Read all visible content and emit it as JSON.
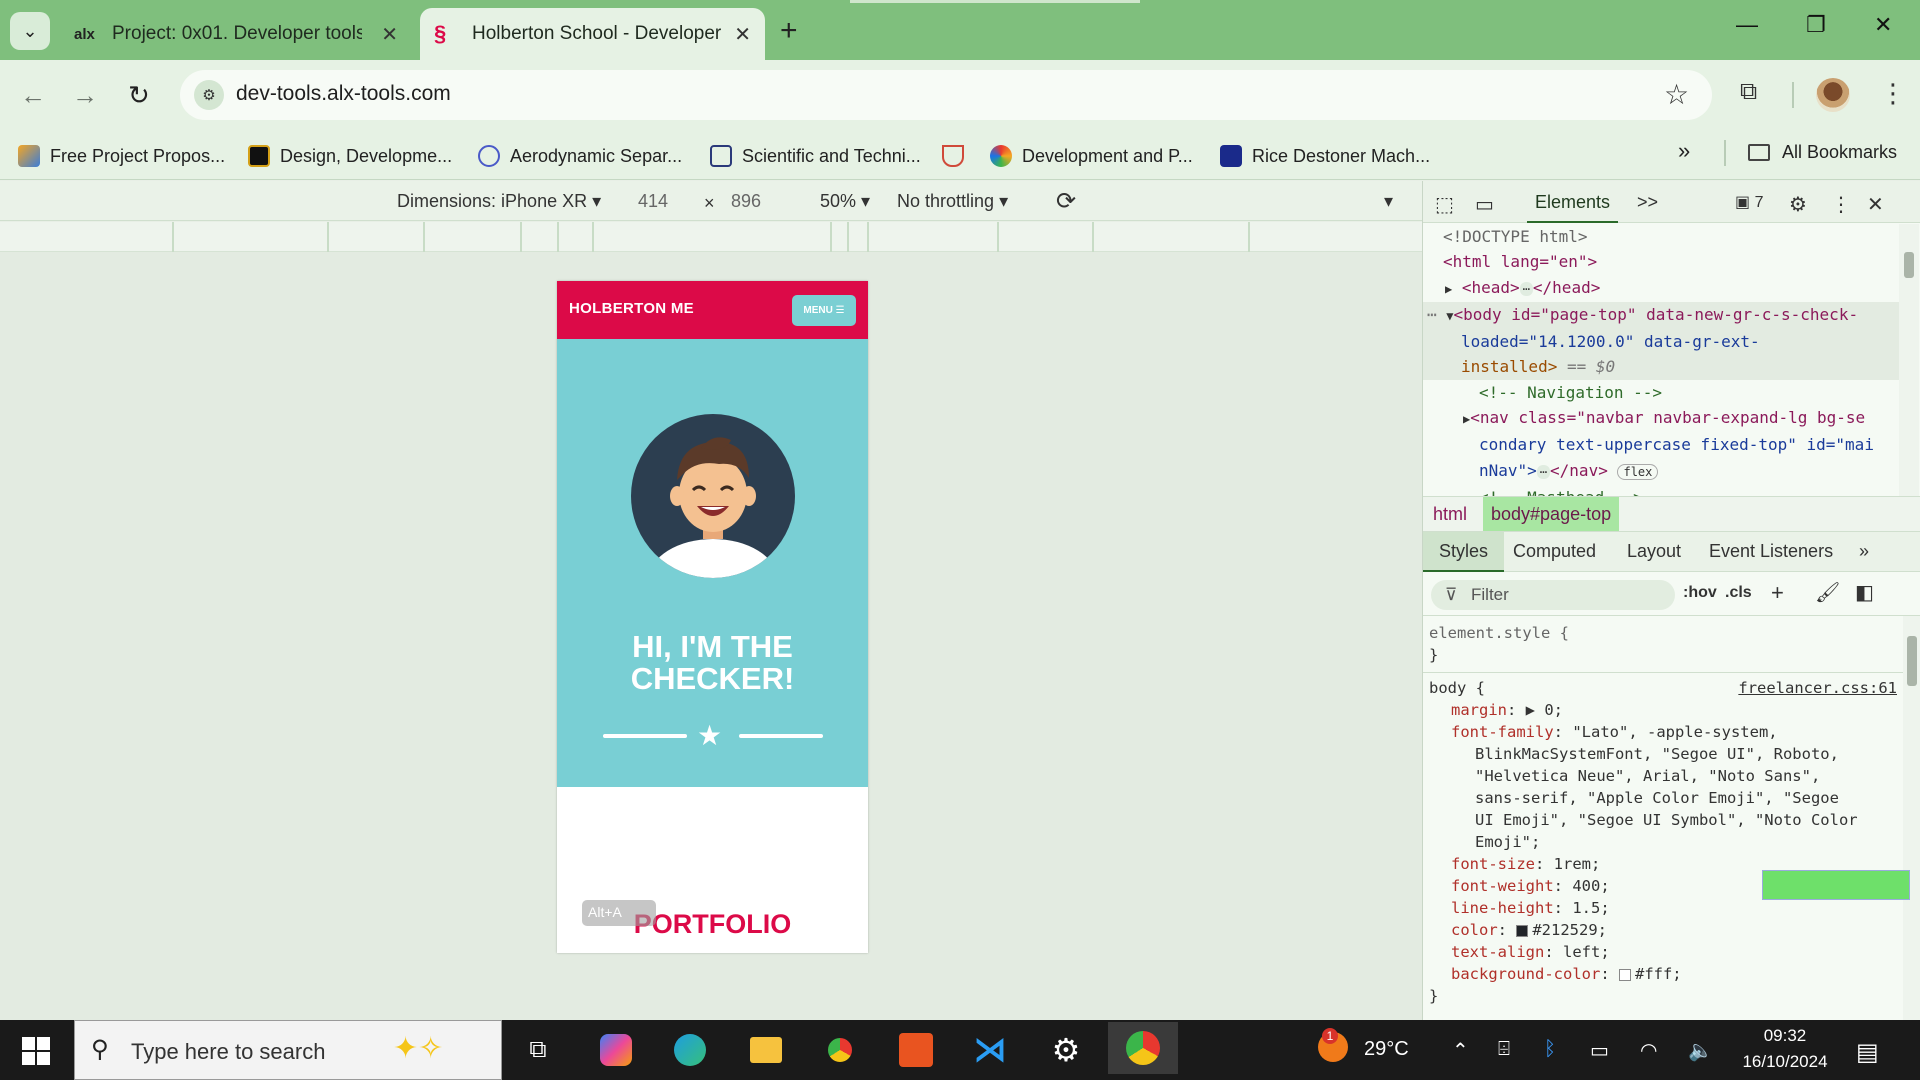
{
  "browser": {
    "tabs": [
      {
        "favicon": "alx",
        "title": "Project: 0x01. Developer tools |"
      },
      {
        "favicon": "seahorse",
        "title": "Holberton School - Developer t"
      }
    ],
    "url": "dev-tools.alx-tools.com",
    "bookmarks": [
      "Free Project Propos...",
      "Design, Developme...",
      "Aerodynamic Separ...",
      "Scientific and Techni...",
      "",
      "Development and P...",
      "Rice Destoner Mach..."
    ],
    "bookmarks_more": "»",
    "all_bookmarks": "All Bookmarks"
  },
  "device_toolbar": {
    "dimensions_label": "Dimensions: iPhone XR",
    "width": "414",
    "times": "×",
    "height": "896",
    "zoom": "50%",
    "throttling": "No throttling"
  },
  "site": {
    "brand": "HOLBERTON ME",
    "menu_button": "MENU",
    "hero_line1": "HI, I'M THE",
    "hero_line2": "CHECKER!",
    "portfolio_heading": "PORTFOLIO",
    "overlay_hint": "Alt+A"
  },
  "devtools": {
    "elements_tab": "Elements",
    "more_tabs": ">>",
    "issues_count": "7",
    "dom_lines": [
      {
        "html": "<span class='cmt'>&lt;!DOCTYPE html&gt;</span>",
        "indent": 0
      },
      {
        "html": "<span class='tag'>&lt;html</span> <span class='attr-n'>lang</span>=<span class='attr-v'>\"en\"</span><span class='tag'>&gt;</span>",
        "indent": 0
      }
    ],
    "dom": {
      "doctype": "<!DOCTYPE html>",
      "html_open": "<html lang=\"en\">",
      "head": "<head>",
      "head_close": "</head>",
      "body_open": "<body id=\"page-top\" data-new-gr-c-s-check-",
      "body_cont": "loaded=\"14.1200.0\" data-gr-ext-",
      "body_cont2": "installed>",
      "body_eq": "== $0",
      "comment_nav": "<!-- Navigation -->",
      "nav_line1": "<nav class=\"navbar navbar-expand-lg bg-se",
      "nav_line2": "condary text-uppercase fixed-top\" id=\"mai",
      "nav_line3": "nNav\">",
      "nav_close": "</nav>",
      "flex_badge": "flex",
      "comment_masthead": "<!-- Masthead -->"
    },
    "breadcrumb": [
      "html",
      "body#page-top"
    ],
    "style_tabs": [
      "Styles",
      "Computed",
      "Layout",
      "Event Listeners"
    ],
    "filter_placeholder": "Filter",
    "hov": ":hov",
    "cls": ".cls",
    "element_style": "element.style {",
    "close_brace": "}",
    "body_selector": "body {",
    "source_link": "freelancer.css:61",
    "css_rules": [
      {
        "prop": "margin",
        "value": "▶ 0;"
      },
      {
        "prop": "font-family",
        "value": "\"Lato\", -apple-system,"
      },
      {
        "prop": "",
        "value": "BlinkMacSystemFont, \"Segoe UI\", Roboto,"
      },
      {
        "prop": "",
        "value": "\"Helvetica Neue\", Arial, \"Noto Sans\","
      },
      {
        "prop": "",
        "value": "sans-serif, \"Apple Color Emoji\", \"Segoe"
      },
      {
        "prop": "",
        "value": "UI Emoji\", \"Segoe UI Symbol\", \"Noto Color"
      },
      {
        "prop": "",
        "value": "Emoji\";"
      },
      {
        "prop": "font-size",
        "value": "1rem;"
      },
      {
        "prop": "font-weight",
        "value": "400;"
      },
      {
        "prop": "line-height",
        "value": "1.5;"
      },
      {
        "prop": "color",
        "value": "#212529;"
      },
      {
        "prop": "text-align",
        "value": "left;"
      },
      {
        "prop": "background-color",
        "value": "#fff;"
      }
    ]
  },
  "taskbar": {
    "search_placeholder": "Type here to search",
    "temperature": "29°C",
    "time": "09:32",
    "date": "16/10/2024",
    "weather_badge": "1"
  },
  "colors": {
    "site_primary": "#dc0a48",
    "site_teal": "#79cfd4",
    "browser_frame": "#7fbf7d"
  }
}
